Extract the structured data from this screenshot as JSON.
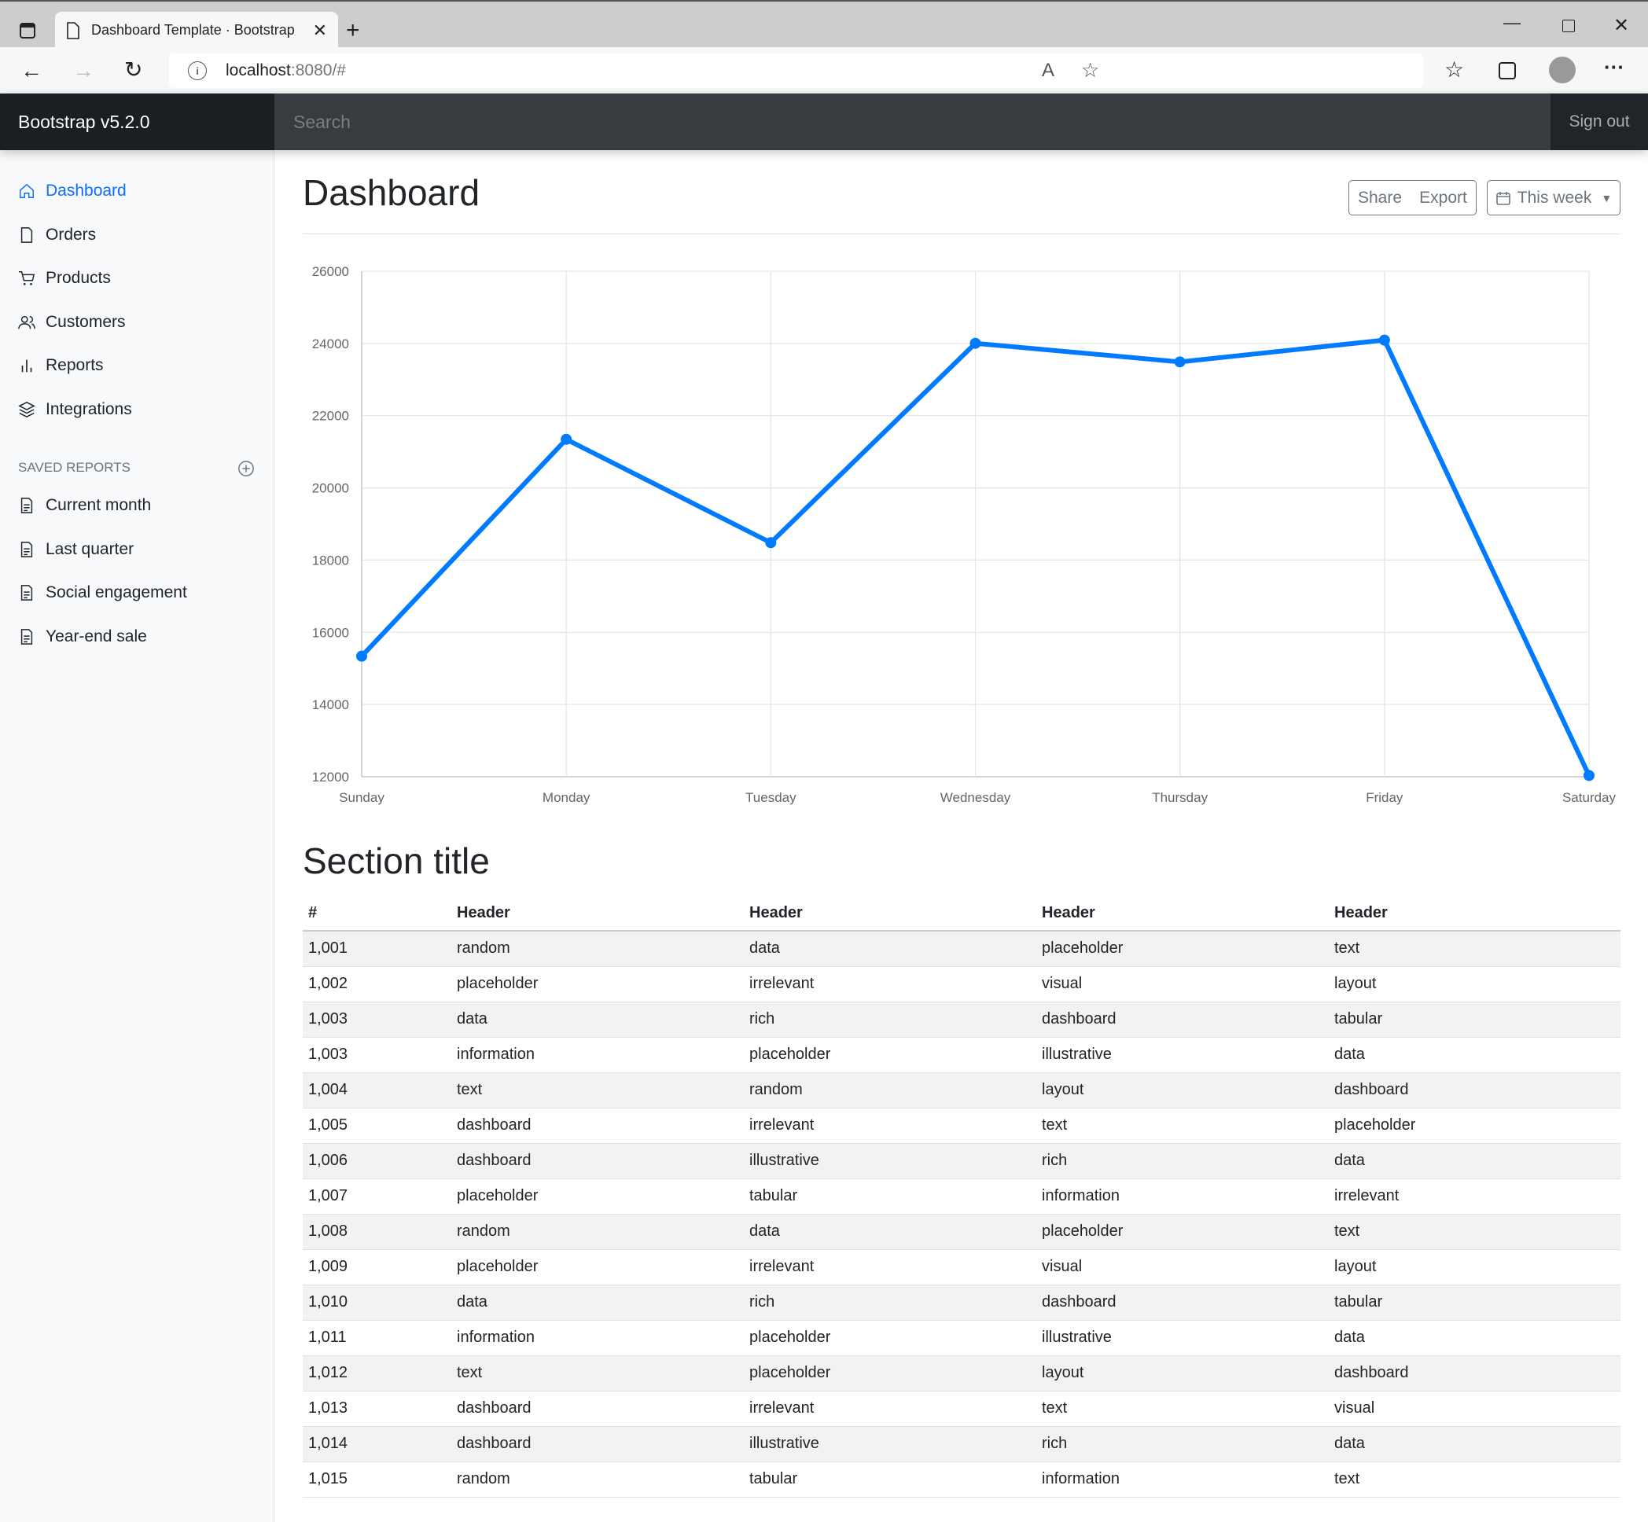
{
  "browser": {
    "tab_title": "Dashboard Template · Bootstrap",
    "url_host": "localhost",
    "url_rest": ":8080/#"
  },
  "navbar": {
    "brand": "Bootstrap v5.2.0",
    "search_placeholder": "Search",
    "signout": "Sign out"
  },
  "sidebar": {
    "items": [
      {
        "label": "Dashboard",
        "icon": "home-icon",
        "active": true
      },
      {
        "label": "Orders",
        "icon": "file-icon"
      },
      {
        "label": "Products",
        "icon": "cart-icon"
      },
      {
        "label": "Customers",
        "icon": "users-icon"
      },
      {
        "label": "Reports",
        "icon": "bar-chart-icon"
      },
      {
        "label": "Integrations",
        "icon": "layers-icon"
      }
    ],
    "saved_heading": "Saved reports",
    "saved": [
      {
        "label": "Current month"
      },
      {
        "label": "Last quarter"
      },
      {
        "label": "Social engagement"
      },
      {
        "label": "Year-end sale"
      }
    ]
  },
  "main": {
    "title": "Dashboard",
    "share": "Share",
    "export": "Export",
    "period": "This week",
    "section_title": "Section title"
  },
  "chart_data": {
    "type": "line",
    "categories": [
      "Sunday",
      "Monday",
      "Tuesday",
      "Wednesday",
      "Thursday",
      "Friday",
      "Saturday"
    ],
    "values": [
      15339,
      21345,
      18483,
      24003,
      23489,
      24092,
      12034
    ],
    "ylim": [
      12000,
      26000
    ],
    "yticks": [
      12000,
      14000,
      16000,
      18000,
      20000,
      22000,
      24000,
      26000
    ],
    "grid": true,
    "color": "#007bff"
  },
  "table": {
    "headers": [
      "#",
      "Header",
      "Header",
      "Header",
      "Header"
    ],
    "rows": [
      [
        "1,001",
        "random",
        "data",
        "placeholder",
        "text"
      ],
      [
        "1,002",
        "placeholder",
        "irrelevant",
        "visual",
        "layout"
      ],
      [
        "1,003",
        "data",
        "rich",
        "dashboard",
        "tabular"
      ],
      [
        "1,003",
        "information",
        "placeholder",
        "illustrative",
        "data"
      ],
      [
        "1,004",
        "text",
        "random",
        "layout",
        "dashboard"
      ],
      [
        "1,005",
        "dashboard",
        "irrelevant",
        "text",
        "placeholder"
      ],
      [
        "1,006",
        "dashboard",
        "illustrative",
        "rich",
        "data"
      ],
      [
        "1,007",
        "placeholder",
        "tabular",
        "information",
        "irrelevant"
      ],
      [
        "1,008",
        "random",
        "data",
        "placeholder",
        "text"
      ],
      [
        "1,009",
        "placeholder",
        "irrelevant",
        "visual",
        "layout"
      ],
      [
        "1,010",
        "data",
        "rich",
        "dashboard",
        "tabular"
      ],
      [
        "1,011",
        "information",
        "placeholder",
        "illustrative",
        "data"
      ],
      [
        "1,012",
        "text",
        "placeholder",
        "layout",
        "dashboard"
      ],
      [
        "1,013",
        "dashboard",
        "irrelevant",
        "text",
        "visual"
      ],
      [
        "1,014",
        "dashboard",
        "illustrative",
        "rich",
        "data"
      ],
      [
        "1,015",
        "random",
        "tabular",
        "information",
        "text"
      ]
    ]
  }
}
